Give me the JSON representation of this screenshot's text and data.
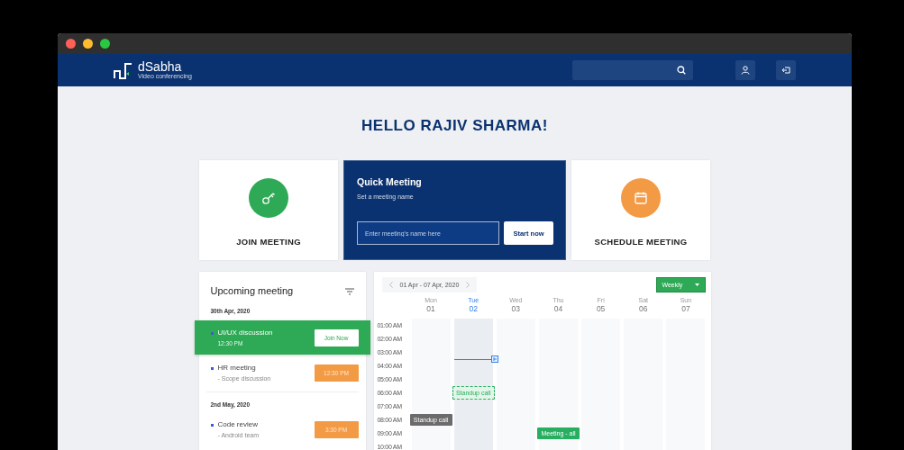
{
  "brand": {
    "name": "dSabha",
    "tagline": "Video conferencing"
  },
  "greeting": "HELLO RAJIV SHARMA!",
  "cards": [
    {
      "kind": "join",
      "label": "JOIN MEETING"
    },
    {
      "kind": "quick",
      "title": "Quick Meeting",
      "subtitle": "Set a meeting name",
      "placeholder": "Enter meeting's name here",
      "button": "Start now"
    },
    {
      "kind": "schedule",
      "label": "SCHEDULE MEETING"
    }
  ],
  "upcoming": {
    "title": "Upcoming meeting",
    "groups": [
      {
        "date": "30th Apr, 2020",
        "meetings": [
          {
            "title": "UI/UX discussion",
            "detail": "12:30 PM",
            "action": "Join Now",
            "selected": true
          },
          {
            "title": "HR meeting",
            "detail": "- Scope discussion",
            "action": "12:30 PM",
            "selected": false
          }
        ]
      },
      {
        "date": "2nd May, 2020",
        "meetings": [
          {
            "title": "Code review",
            "detail": "- Android team",
            "action": "3:30 PM",
            "selected": false
          }
        ]
      }
    ]
  },
  "calendar": {
    "range": "01 Apr - 07 Apr, 2020",
    "view": "Weekly",
    "days": [
      {
        "name": "Mon",
        "date": "01",
        "selected": false
      },
      {
        "name": "Tue",
        "date": "02",
        "selected": true
      },
      {
        "name": "Wed",
        "date": "03",
        "selected": false
      },
      {
        "name": "Thu",
        "date": "04",
        "selected": false
      },
      {
        "name": "Fri",
        "date": "05",
        "selected": false
      },
      {
        "name": "Sat",
        "date": "06",
        "selected": false
      },
      {
        "name": "Sun",
        "date": "07",
        "selected": false
      }
    ],
    "rows": [
      {
        "time": "01:00 AM"
      },
      {
        "time": "02:00 AM"
      },
      {
        "time": "03:00 AM"
      },
      {
        "time": "04:00 AM"
      },
      {
        "time": "05:00 AM"
      },
      {
        "time": "06:00 AM",
        "cells": [
          {
            "kind": "empty"
          },
          {
            "kind": "dashed",
            "title": "Standup call",
            "color": "#27ae60"
          }
        ]
      },
      {
        "time": "07:00 AM"
      },
      {
        "time": "08:00 AM",
        "cells": [
          {
            "kind": "solid",
            "title": "Standup call",
            "color": "#6b6b6b"
          }
        ]
      },
      {
        "time": "09:00 AM",
        "cells": [
          {
            "kind": "empty"
          },
          {
            "kind": "empty"
          },
          {
            "kind": "empty"
          },
          {
            "kind": "solid",
            "title": "Meeting - all",
            "color": "#27ae60"
          }
        ]
      },
      {
        "time": "10:00 AM"
      }
    ]
  }
}
